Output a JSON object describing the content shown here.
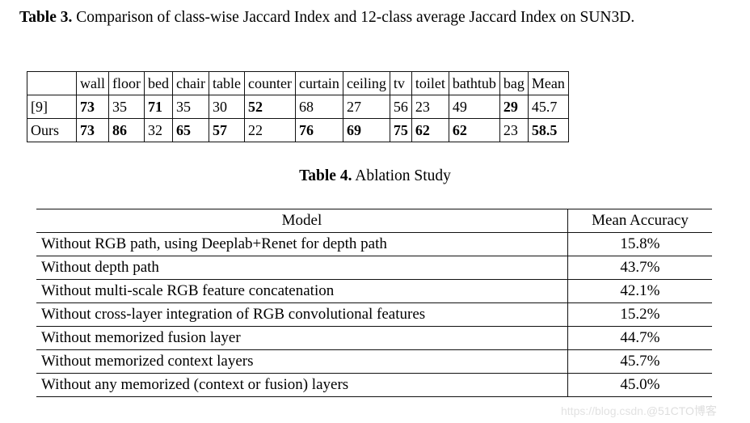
{
  "table3": {
    "caption_label": "Table 3.",
    "caption_text": "Comparison of class-wise Jaccard Index and 12-class average Jaccard Index on SUN3D.",
    "columns": [
      "",
      "wall",
      "floor",
      "bed",
      "chair",
      "table",
      "counter",
      "curtain",
      "ceiling",
      "tv",
      "toilet",
      "bathtub",
      "bag",
      "Mean"
    ],
    "rows": [
      {
        "label": "[9]",
        "cells": [
          {
            "value": "73",
            "bold": true
          },
          {
            "value": "35",
            "bold": false
          },
          {
            "value": "71",
            "bold": true
          },
          {
            "value": "35",
            "bold": false
          },
          {
            "value": "30",
            "bold": false
          },
          {
            "value": "52",
            "bold": true
          },
          {
            "value": "68",
            "bold": false
          },
          {
            "value": "27",
            "bold": false
          },
          {
            "value": "56",
            "bold": false
          },
          {
            "value": "23",
            "bold": false
          },
          {
            "value": "49",
            "bold": false
          },
          {
            "value": "29",
            "bold": true
          },
          {
            "value": "45.7",
            "bold": false
          }
        ]
      },
      {
        "label": "Ours",
        "cells": [
          {
            "value": "73",
            "bold": true
          },
          {
            "value": "86",
            "bold": true
          },
          {
            "value": "32",
            "bold": false
          },
          {
            "value": "65",
            "bold": true
          },
          {
            "value": "57",
            "bold": true
          },
          {
            "value": "22",
            "bold": false
          },
          {
            "value": "76",
            "bold": true
          },
          {
            "value": "69",
            "bold": true
          },
          {
            "value": "75",
            "bold": true
          },
          {
            "value": "62",
            "bold": true
          },
          {
            "value": "62",
            "bold": true
          },
          {
            "value": "23",
            "bold": false
          },
          {
            "value": "58.5",
            "bold": true
          }
        ]
      }
    ]
  },
  "table4": {
    "caption_label": "Table 4.",
    "caption_text": "Ablation Study",
    "columns": [
      "Model",
      "Mean Accuracy"
    ],
    "rows": [
      {
        "model": "Without RGB path, using Deeplab+Renet for depth path",
        "accuracy": "15.8%"
      },
      {
        "model": "Without depth path",
        "accuracy": "43.7%"
      },
      {
        "model": "Without multi-scale RGB feature concatenation",
        "accuracy": "42.1%"
      },
      {
        "model": "Without cross-layer integration of RGB convolutional features",
        "accuracy": "15.2%"
      },
      {
        "model": "Without memorized fusion layer",
        "accuracy": "44.7%"
      },
      {
        "model": "Without memorized context layers",
        "accuracy": "45.7%"
      },
      {
        "model": "Without any memorized (context or fusion) layers",
        "accuracy": "45.0%"
      }
    ]
  },
  "watermark": {
    "url_text": "https://blog.csdn.",
    "site_text": "@51CTO博客"
  }
}
